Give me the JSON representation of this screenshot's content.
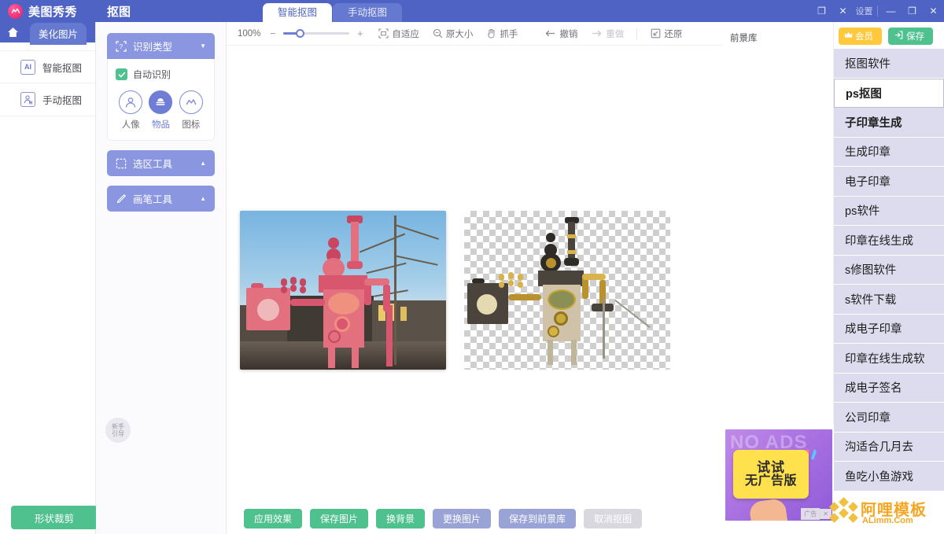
{
  "app": {
    "brand": "美图秀秀",
    "doc_title": "抠图",
    "accent_purple": "#4f63c4",
    "accent_green": "#4fc18f",
    "accent_yellow": "#ffc83d",
    "panel_purple": "#8a97e0"
  },
  "tabs": [
    {
      "label": "智能抠图",
      "active": true
    },
    {
      "label": "手动抠图",
      "active": false
    }
  ],
  "window_controls": {
    "overlay_restore": "❐",
    "overlay_close": "✕",
    "settings_label": "设置",
    "minimize": "—",
    "maximize": "❐",
    "close": "✕"
  },
  "left_rail": {
    "home_icon": "home-icon",
    "beautify_tab": "美化图片",
    "items": [
      {
        "label": "智能抠图",
        "icon_text": "AI",
        "icon": "ai-badge-icon"
      },
      {
        "label": "手动抠图",
        "icon_text": "M",
        "icon": "manual-person-icon"
      }
    ],
    "shape_crop_button": "形状裁剪"
  },
  "tool_panel": {
    "recognize": {
      "title": "识别类型",
      "icon": "recognize-type-icon",
      "chevron": "▼",
      "auto_checkbox_label": "自动识别",
      "auto_checked": true,
      "types": [
        {
          "label": "人像",
          "icon": "portrait-icon",
          "selected": false
        },
        {
          "label": "物品",
          "icon": "object-icon",
          "selected": true
        },
        {
          "label": "图标",
          "icon": "logo-icon",
          "selected": false
        }
      ]
    },
    "selection_tool": {
      "title": "选区工具",
      "icon": "selection-tool-icon",
      "chevron": "▲"
    },
    "brush_tool": {
      "title": "画笔工具",
      "icon": "brush-tool-icon",
      "chevron": "▲"
    },
    "guide_badge": {
      "line1": "新手",
      "line2": "引导"
    }
  },
  "canvas_toolbar": {
    "zoom_value": "100%",
    "zoom_out": "−",
    "zoom_in": "+",
    "zoom_percent_number": 100,
    "buttons": [
      {
        "label": "自适应",
        "icon": "fit-screen-icon",
        "disabled": false
      },
      {
        "label": "原大小",
        "icon": "actual-size-icon",
        "disabled": false
      },
      {
        "label": "抓手",
        "icon": "hand-tool-icon",
        "disabled": false
      },
      {
        "label": "撤销",
        "icon": "undo-arrow-icon",
        "disabled": false
      },
      {
        "label": "重做",
        "icon": "redo-arrow-icon",
        "disabled": true
      },
      {
        "label": "还原",
        "icon": "restore-icon",
        "disabled": false
      }
    ]
  },
  "canvas": {
    "original_alt": "原图 蒸汽朋克雕塑",
    "cutout_alt": "抠图结果 透明背景"
  },
  "bottom_actions": [
    {
      "label": "应用效果",
      "style": "green"
    },
    {
      "label": "保存图片",
      "style": "green"
    },
    {
      "label": "换背景",
      "style": "green"
    },
    {
      "label": "更换图片",
      "style": "purple"
    },
    {
      "label": "保存到前景库",
      "style": "purple"
    },
    {
      "label": "取消抠图",
      "style": "gray"
    }
  ],
  "foreground_library": {
    "title": "前景库"
  },
  "top_actions": {
    "vip_label": "会员",
    "vip_icon": "crown-icon",
    "save_label": "保存",
    "save_icon": "save-export-icon"
  },
  "suggestions": [
    {
      "text": "抠图软件",
      "type": "item",
      "bold": false
    },
    {
      "text": "ps抠图",
      "type": "input",
      "bold": true
    },
    {
      "text": "子印章生成",
      "type": "item",
      "bold": true
    },
    {
      "text": "生成印章",
      "type": "item",
      "bold": false
    },
    {
      "text": "电子印章",
      "type": "item",
      "bold": false
    },
    {
      "text": "ps软件",
      "type": "item",
      "bold": false
    },
    {
      "text": "印章在线生成",
      "type": "item",
      "bold": false
    },
    {
      "text": "s修图软件",
      "type": "item",
      "bold": false
    },
    {
      "text": "s软件下载",
      "type": "item",
      "bold": false
    },
    {
      "text": "成电子印章",
      "type": "item",
      "bold": false
    },
    {
      "text": "印章在线生成软",
      "type": "item",
      "bold": false
    },
    {
      "text": "成电子签名",
      "type": "item",
      "bold": false
    },
    {
      "text": "公司印章",
      "type": "item",
      "bold": false
    },
    {
      "text": "沟适合几月去",
      "type": "item",
      "bold": false
    },
    {
      "text": "鱼吃小鱼游戏",
      "type": "item",
      "bold": false
    }
  ],
  "ad": {
    "headline": "NO ADS",
    "badge_line1": "试试",
    "badge_line2": "无广告版",
    "close_label": "✕",
    "info_label": "广告"
  },
  "watermark": {
    "title": "阿哩模板",
    "subtitle": "ALimm.Com"
  }
}
